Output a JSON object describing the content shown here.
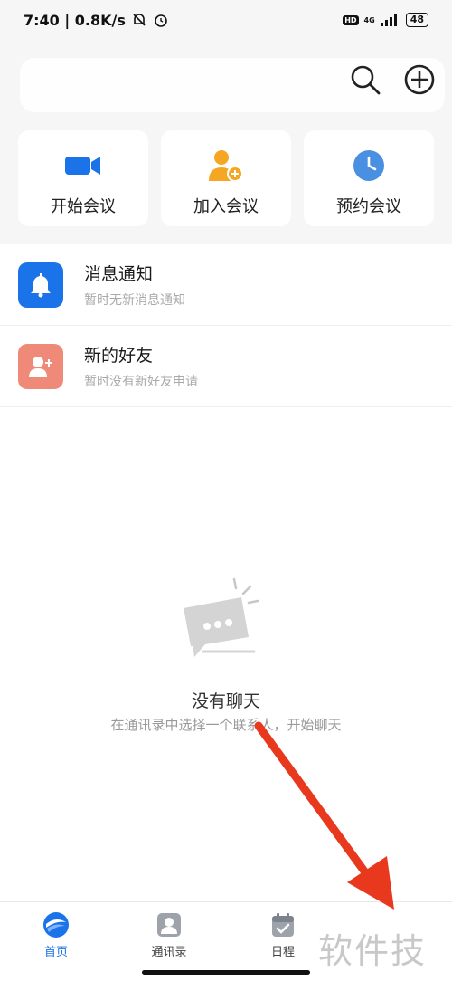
{
  "status_bar": {
    "time_speed": "7:40 | 0.8K/s",
    "hd": "HD",
    "network": "4G",
    "battery": "48"
  },
  "header": {
    "search_icon": "search-icon",
    "add_icon": "plus-circle-icon"
  },
  "quick_actions": [
    {
      "label": "开始会议",
      "icon": "video-camera-icon",
      "color": "#1a73e8"
    },
    {
      "label": "加入会议",
      "icon": "person-add-icon",
      "color": "#f5a623"
    },
    {
      "label": "预约会议",
      "icon": "clock-icon",
      "color": "#4a90e2"
    }
  ],
  "list": [
    {
      "title": "消息通知",
      "subtitle": "暂时无新消息通知",
      "icon": "bell-icon",
      "color": "#1a73e8"
    },
    {
      "title": "新的好友",
      "subtitle": "暂时没有新好友申请",
      "icon": "person-add-icon",
      "color": "#f08a78"
    }
  ],
  "empty_state": {
    "title": "没有聊天",
    "subtitle": "在通讯录中选择一个联系人，开始聊天"
  },
  "bottom_nav": [
    {
      "label": "首页",
      "icon": "home-logo-icon",
      "active": true
    },
    {
      "label": "通讯录",
      "icon": "contacts-icon",
      "active": false
    },
    {
      "label": "日程",
      "icon": "calendar-check-icon",
      "active": false
    }
  ],
  "watermark": "软件技巧",
  "colors": {
    "accent": "#1a73e8",
    "arrow": "#e8391e"
  }
}
